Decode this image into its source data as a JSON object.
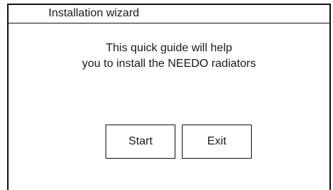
{
  "dialog": {
    "title": "Installation wizard",
    "message_line1": "This quick guide will help",
    "message_line2": "you to install the NEEDO radiators"
  },
  "buttons": {
    "start_label": "Start",
    "exit_label": "Exit"
  }
}
